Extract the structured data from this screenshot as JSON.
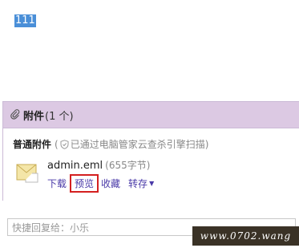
{
  "message": {
    "body_text": "111"
  },
  "attachments": {
    "title": "附件",
    "count": "(1 个)",
    "section_label": "普通附件",
    "scan_status_prefix": "(",
    "scan_status": "已通过电脑管家云查杀引擎扫描)",
    "file": {
      "name": "admin.eml",
      "size": "(655字节)",
      "actions": {
        "download": "下载",
        "preview": "预览",
        "favorite": "收藏",
        "save_to": "转存"
      }
    }
  },
  "reply": {
    "placeholder": "快捷回复给：小乐"
  },
  "watermark": {
    "text": "www.0702.wang"
  },
  "colors": {
    "header_bg": "#dcc9e3",
    "link": "#4a3aa8",
    "highlight_border": "#d42020",
    "selection": "#4a8fd8"
  }
}
